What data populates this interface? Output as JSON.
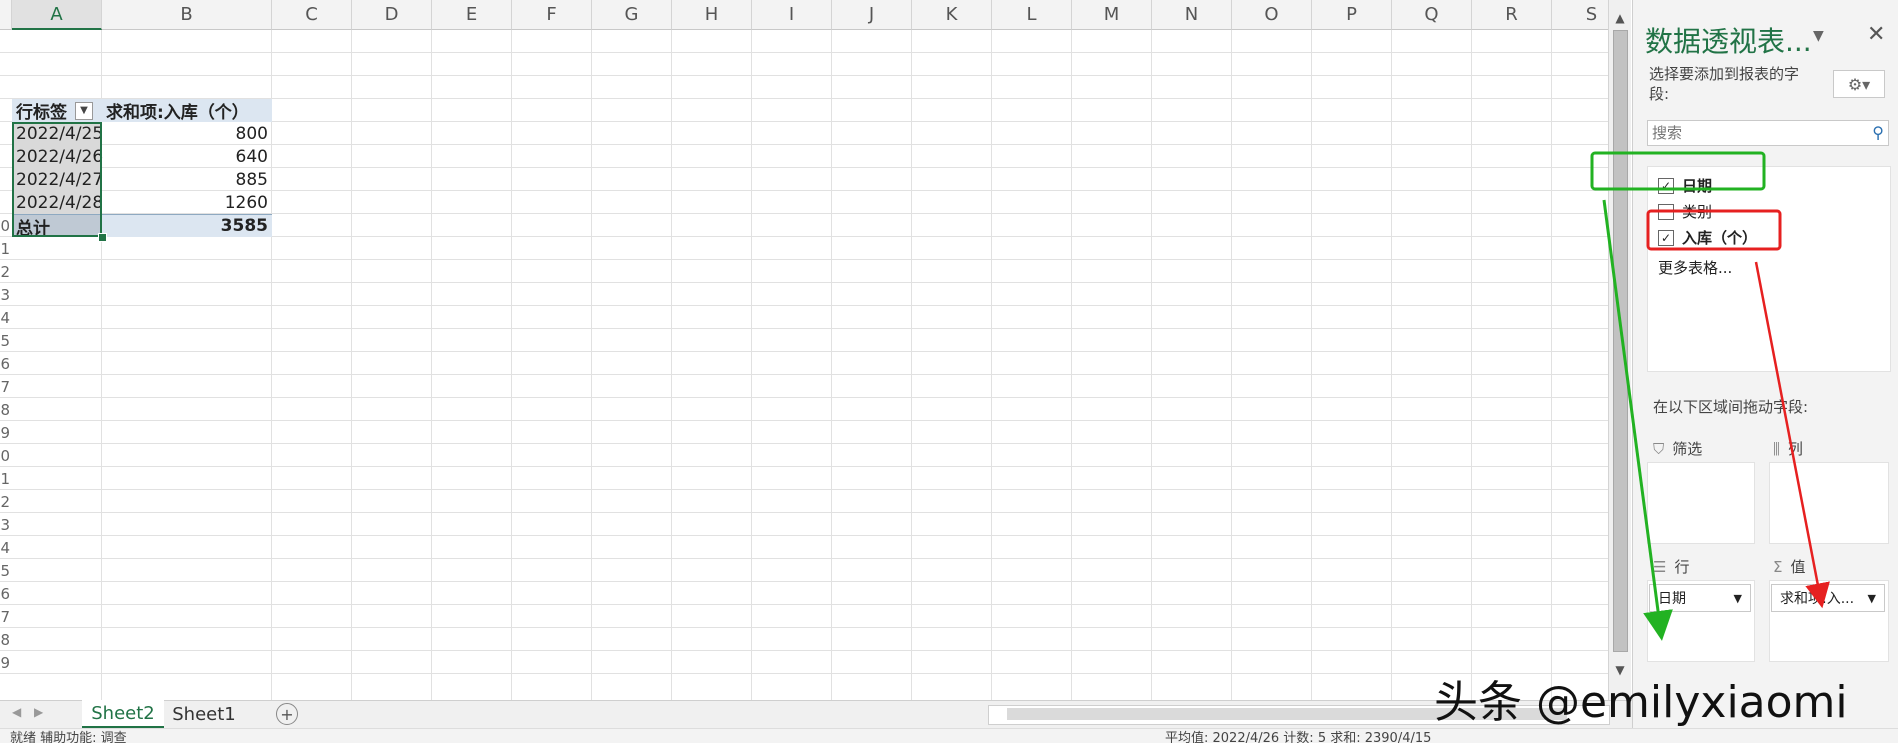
{
  "columns": [
    "A",
    "B",
    "C",
    "D",
    "E",
    "F",
    "G",
    "H",
    "I",
    "J",
    "K",
    "L",
    "M",
    "N",
    "O",
    "P",
    "Q",
    "R",
    "S"
  ],
  "rows": [
    "",
    "",
    "",
    "",
    "",
    "",
    "",
    "",
    "0",
    "1",
    "2",
    "3",
    "4",
    "5",
    "6",
    "7",
    "8",
    "9",
    "0",
    "1",
    "2",
    "3",
    "4",
    "5",
    "6",
    "7",
    "8",
    "9"
  ],
  "pivot": {
    "header_row_label": "行标签",
    "header_value_label": "求和项:入库（个）",
    "rows": [
      {
        "label": "2022/4/25",
        "value": "800"
      },
      {
        "label": "2022/4/26",
        "value": "640"
      },
      {
        "label": "2022/4/27",
        "value": "885"
      },
      {
        "label": "2022/4/28",
        "value": "1260"
      }
    ],
    "total_label": "总计",
    "total_value": "3585"
  },
  "sheets": {
    "tabs": [
      "Sheet2",
      "Sheet1"
    ],
    "active": "Sheet2",
    "add_icon": "plus-circle-icon"
  },
  "panel": {
    "title": "数据透视表...",
    "prompt": "选择要添加到报表的字段:",
    "search_placeholder": "搜索",
    "fields": [
      {
        "label": "日期",
        "checked": true
      },
      {
        "label": "类别",
        "checked": false
      },
      {
        "label": "入库（个）",
        "checked": true
      }
    ],
    "more_tables": "更多表格...",
    "drag_prompt": "在以下区域间拖动字段:",
    "areas": {
      "filter_label": "筛选",
      "columns_label": "列",
      "rows_label": "行",
      "values_label": "值",
      "rows_field": "日期",
      "values_field": "求和项:入..."
    }
  },
  "statusbar": {
    "left": "就绪  辅助功能: 调查",
    "right": "平均值: 2022/4/26    计数: 5    求和: 2390/4/15"
  },
  "watermark": "头条 @emilyxiaomi",
  "colors": {
    "excel_green": "#217346",
    "pivot_header": "#dce6f1",
    "annotation_green": "#22b222",
    "annotation_red": "#e62020"
  }
}
